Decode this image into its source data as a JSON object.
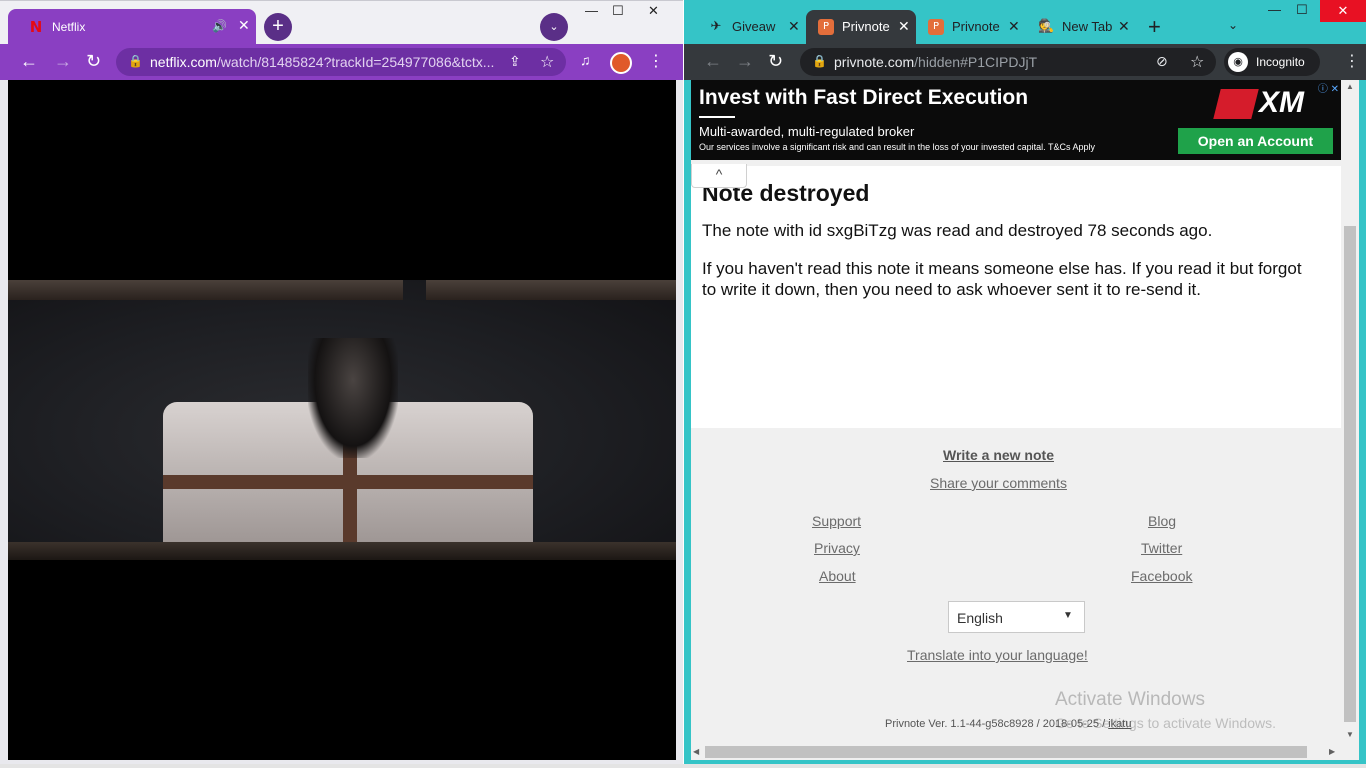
{
  "left": {
    "tab": {
      "title": "Netflix",
      "favicon": "N",
      "audio": "🔊",
      "close": "✕"
    },
    "new_tab": "+",
    "tab_search": "⌄",
    "win": {
      "min": "—",
      "max": "☐",
      "close": "✕"
    },
    "nav": {
      "back": "←",
      "forward": "→",
      "reload": "↻"
    },
    "address": {
      "lock": "🔒",
      "host": "netflix.com",
      "rest": "/watch/81485824?trackId=254977086&tctx...",
      "share": "⇪",
      "star": "☆"
    },
    "media": "♫",
    "menu": "⋮"
  },
  "right": {
    "tabs": [
      {
        "title": "Giveaw",
        "favicon": "✈",
        "close": "✕"
      },
      {
        "title": "Privnote",
        "favicon": "P",
        "close": "✕"
      },
      {
        "title": "Privnote",
        "favicon": "P",
        "close": "✕"
      },
      {
        "title": "New Tab",
        "favicon": "🕵",
        "close": "✕"
      }
    ],
    "new_tab": "+",
    "tab_search": "⌄",
    "win": {
      "min": "—",
      "max": "☐",
      "close": "✕"
    },
    "nav": {
      "back": "←",
      "forward": "→",
      "reload": "↻"
    },
    "address": {
      "lock": "🔒",
      "host": "privnote.com",
      "rest": "/hidden#P1CIPDJjT",
      "eye": "⊘",
      "star": "☆"
    },
    "incognito": {
      "icon": "◉",
      "label": "Incognito"
    },
    "menu": "⋮",
    "ad": {
      "headline": "Invest with Fast Direct Execution",
      "sub": "Multi-awarded, multi-regulated broker",
      "small": "Our services involve a significant risk and can result in the loss of your invested capital. T&Cs Apply",
      "logo": "XM",
      "cta": "Open an Account",
      "info": "ⓘ ✕"
    },
    "collapse": "^",
    "note": {
      "title": "Note destroyed",
      "line1": "The note with id sxgBiTzg was read and destroyed 78 seconds ago.",
      "line2": "If you haven't read this note it means someone else has. If you read it but forgot to write it down, then you need to ask whoever sent it to re-send it."
    },
    "footer": {
      "write": "Write a new note",
      "share": "Share your comments",
      "support": "Support",
      "privacy": "Privacy",
      "about": "About",
      "blog": "Blog",
      "twitter": "Twitter",
      "facebook": "Facebook",
      "translate": "Translate into your language!"
    },
    "language": "English",
    "version_text": "Privnote Ver. 1.1-44-g58c8928 / 2018-05-25 / ",
    "version_link": "ikatu",
    "watermark_title": "Activate Windows",
    "watermark_sub": "Go to Settings to activate Windows.",
    "scroll": {
      "up": "▲",
      "down": "▼",
      "left": "◀",
      "right": "▶"
    }
  }
}
